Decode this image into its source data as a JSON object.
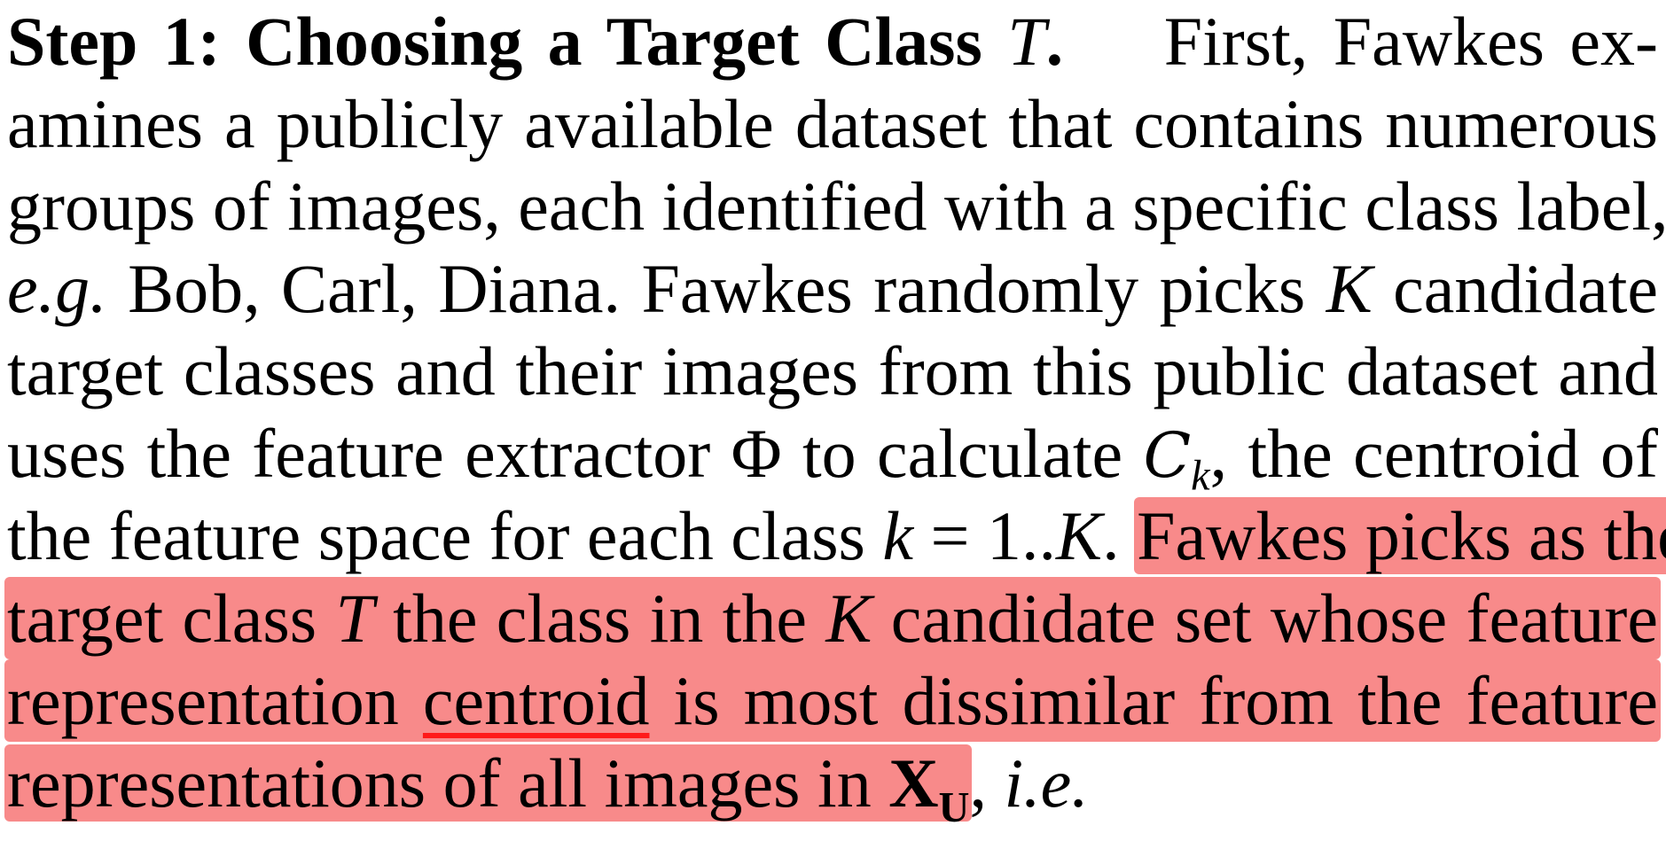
{
  "heading": "Step 1: Choosing a Target Class",
  "heading_var": "T",
  "heading_dot": ".",
  "lines": {
    "l1_rest": "First, Fawkes ex-",
    "l2": "amines a publicly available dataset that contains numerous",
    "l3": "groups of images, each identified with a specific class label,",
    "l4_eg": "e.g.",
    "l4_rest_a": " Bob, Carl, Diana. Fawkes randomly picks ",
    "l4_K": "K",
    "l4_rest_b": " candidate",
    "l5": "target classes and their images from this public dataset and",
    "l6_a": "uses the feature extractor Φ to calculate ",
    "l6_C": "C",
    "l6_k": "k",
    "l6_b": ", the centroid of",
    "l7_a": "the feature space for each class ",
    "l7_k": "k",
    "l7_eq": " = 1..",
    "l7_K": "K",
    "l7_dot": ". ",
    "l7_hl": "Fawkes picks as the",
    "l8_a": "target class ",
    "l8_T": "T",
    "l8_b": " the class in the ",
    "l8_K": "K",
    "l8_c": " candidate set whose feature",
    "l9_a": "representation ",
    "l9_ul": "centroid",
    "l9_b": " is most dissimilar from the feature",
    "l10_hl": "representations of all images in ",
    "l10_X": "X",
    "l10_U": "U",
    "l10_comma": ", ",
    "l10_ie": "i.e."
  },
  "colors": {
    "highlight": "#f88a8a",
    "underline": "#ff1a1a"
  }
}
